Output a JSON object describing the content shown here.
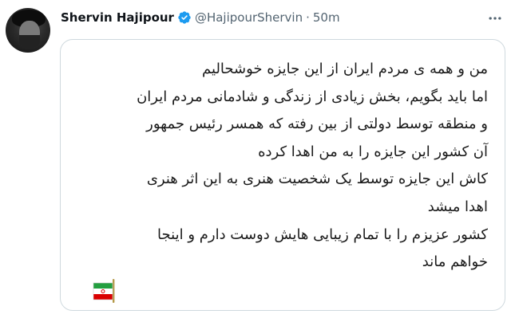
{
  "author": {
    "name": "Shervin Hajipour",
    "handle": "@HajipourShervin",
    "separator": "·",
    "time": "50m",
    "verified_color": "#1d9bf0"
  },
  "tweet": {
    "lines": [
      "من و همه ی مردم ایران از این جایزه خوشحالیم",
      "اما باید بگویم، بخش زیادی از زندگی و شادمانی مردم ایران",
      "و منطقه توسط دولتی از بین رفته که همسر رئیس جمهور",
      "آن کشور این جایزه را به من اهدا کرده",
      "کاش این جایزه توسط یک شخصیت هنری به این اثر هنری",
      "اهدا میشد",
      "کشور عزیزم را با تمام زیبایی هایش دوست دارم و اینجا",
      "خواهم ماند"
    ],
    "flag_icon": "iran-flag-icon",
    "flag_colors": {
      "green": "#239f40",
      "white": "#ffffff",
      "red": "#da0000",
      "emblem": "#da0000"
    }
  },
  "icons": {
    "more": "more-options-icon",
    "verified": "verified-badge-icon"
  },
  "colors": {
    "text_primary": "#0f1419",
    "text_secondary": "#536471",
    "card_border": "#cfd9de"
  }
}
